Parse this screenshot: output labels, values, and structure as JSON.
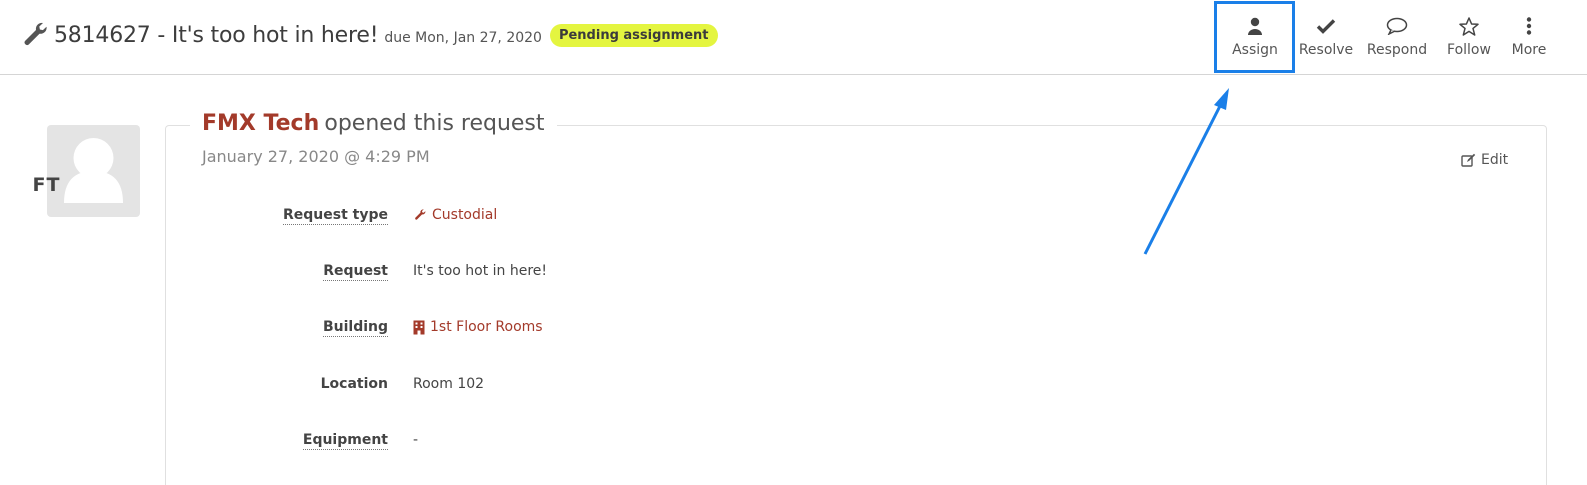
{
  "header": {
    "ticket_title": "5814627 - It's too hot in here!",
    "due": "due Mon, Jan 27, 2020",
    "status_badge": "Pending assignment"
  },
  "actions": [
    {
      "label": "Assign",
      "icon": "user-icon"
    },
    {
      "label": "Resolve",
      "icon": "check-icon"
    },
    {
      "label": "Respond",
      "icon": "speech-bubble-icon"
    },
    {
      "label": "Follow",
      "icon": "star-icon"
    },
    {
      "label": "More",
      "icon": "vertical-dots-icon"
    }
  ],
  "request": {
    "avatar_initials": "FT",
    "author": "FMX Tech",
    "action_text": "opened this request",
    "timestamp": "January 27, 2020 @ 4:29 PM",
    "edit_label": "Edit",
    "fields": [
      {
        "label": "Request type",
        "value": "Custodial"
      },
      {
        "label": "Request",
        "value": "It's too hot in here!"
      },
      {
        "label": "Building",
        "value": "1st Floor Rooms"
      },
      {
        "label": "Location",
        "value": "Room 102"
      },
      {
        "label": "Equipment",
        "value": "-"
      }
    ]
  },
  "colors": {
    "accent_link": "#a33a2a",
    "badge": "#e4f540",
    "highlight": "#1a7fe8"
  }
}
